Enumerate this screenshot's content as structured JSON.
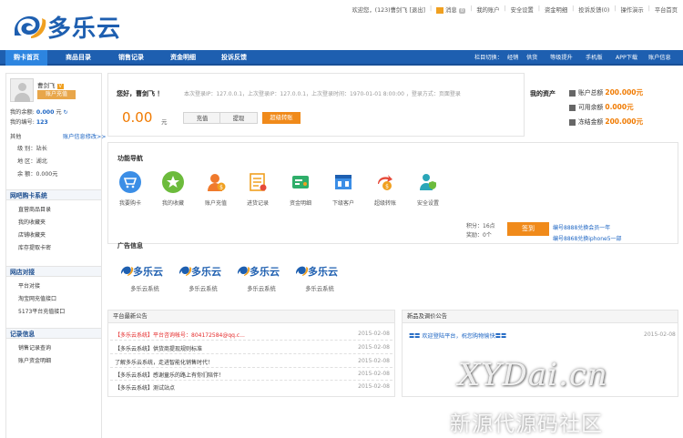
{
  "brand": {
    "logo_text": "多乐云"
  },
  "top_links": {
    "greeting": "欢迎您，(123)曹剑飞 [",
    "logout": "退出",
    "greeting_end": "]",
    "messages": "消息",
    "message_count": "0",
    "my_account": "我的账户",
    "security": "安全设置",
    "funds": "资金明细",
    "complaints": "投诉反馈(0)",
    "demo": "操作演示",
    "platform": "平台首页"
  },
  "nav": {
    "items": [
      "购卡首页",
      "商品目录",
      "销售记录",
      "资金明细",
      "投诉反馈"
    ],
    "right": [
      "栏目切换：",
      "经销",
      "供货",
      "等级提升",
      "手机版",
      "APP下载",
      "账户信息"
    ]
  },
  "sidebar": {
    "username": "曹剑飞",
    "vip": "V",
    "recharge": "账户充值",
    "balance_label": "我的余额:",
    "balance_value": "0.000",
    "balance_unit": "元",
    "refresh_icon": "refresh-icon",
    "id_label": "我的编号:",
    "id_value": "123",
    "other_label": "其他",
    "modify_link": "账户信息修改>>",
    "level": "级 别：站长",
    "region": "地 区：湖北",
    "bail": "余 额：0.000元",
    "sections": [
      {
        "title": "网吧购卡系统",
        "items": [
          "直营商品目录",
          "我的收藏夹",
          "店铺收藏夹",
          "库存提取卡密"
        ]
      },
      {
        "title": "网店对接",
        "items": [
          "平台对接",
          "淘宝网充值接口",
          "5173平台充值接口"
        ]
      },
      {
        "title": "记录信息",
        "items": [
          "销售记录查询",
          "账户资金明细"
        ]
      }
    ]
  },
  "welcome": {
    "title": "您好，曹剑飞 ！",
    "login_info": "本次登录IP：127.0.0.1，上次登录IP：127.0.0.1，上次登录时间：1970-01-01 8:00:00 ，登录方式：页面登录",
    "balance": "0.00",
    "unit": "元",
    "btn_recharge": "充值",
    "btn_withdraw": "提现",
    "btn_transfer": "超级转账"
  },
  "assets": {
    "title": "我的资产",
    "rows": [
      {
        "label": "账户总额",
        "value": "200.000元"
      },
      {
        "label": "可用余额",
        "value": "0.000元"
      },
      {
        "label": "冻结金额",
        "value": "200.000元"
      }
    ]
  },
  "functions": {
    "title": "功能导航",
    "items": [
      {
        "label": "我要购卡",
        "icon": "cart-icon",
        "color": "#3b8ee6"
      },
      {
        "label": "我的收藏",
        "icon": "star-icon",
        "color": "#6cbb3c"
      },
      {
        "label": "账户充值",
        "icon": "recharge-icon",
        "color": "#f07a2c"
      },
      {
        "label": "进货记录",
        "icon": "record-icon",
        "color": "#f0a020"
      },
      {
        "label": "资金明细",
        "icon": "funds-icon",
        "color": "#2fae6a"
      },
      {
        "label": "下级客户",
        "icon": "customers-icon",
        "color": "#3b8ee6"
      },
      {
        "label": "超级转账",
        "icon": "transfer-icon",
        "color": "#e64a3a"
      },
      {
        "label": "安全设置",
        "icon": "security-icon",
        "color": "#2aa6b8"
      }
    ],
    "points": "积分：16点",
    "coins": "奖励：0个",
    "signin": "签到",
    "links": [
      "编号8888兑换会员一年",
      "编号8868兑换iphone5一部"
    ]
  },
  "ads": {
    "title": "广告信息",
    "items": [
      "多乐云系统",
      "多乐云系统",
      "多乐云系统",
      "多乐云系统"
    ]
  },
  "notices": {
    "title": "平台最新公告",
    "rows": [
      {
        "tag": "【多乐云系统】",
        "text": "平台咨询帐号：804172584@qq.c...",
        "date": "2015-02-08"
      },
      {
        "tag": "【多乐云系统】",
        "text": "供货商提现规则标准",
        "date": "2015-02-08"
      },
      {
        "tag": "",
        "text": "了解多乐云系统，走进智能化销售时代！",
        "date": "2015-02-08"
      },
      {
        "tag": "【多乐云系统】",
        "text": "感谢童乐的路上有你们陪伴！",
        "date": "2015-02-08"
      },
      {
        "tag": "【多乐云系统】",
        "text": "测试站点",
        "date": "2015-02-08"
      }
    ]
  },
  "products_notice": {
    "title": "新品及调价公告",
    "text": "〓〓 欢迎登陆平台，祝您购物愉快〓〓",
    "date": "2015-02-08"
  },
  "watermark": {
    "line1": "XYDai.cn",
    "line2": "新源代源码社区"
  }
}
